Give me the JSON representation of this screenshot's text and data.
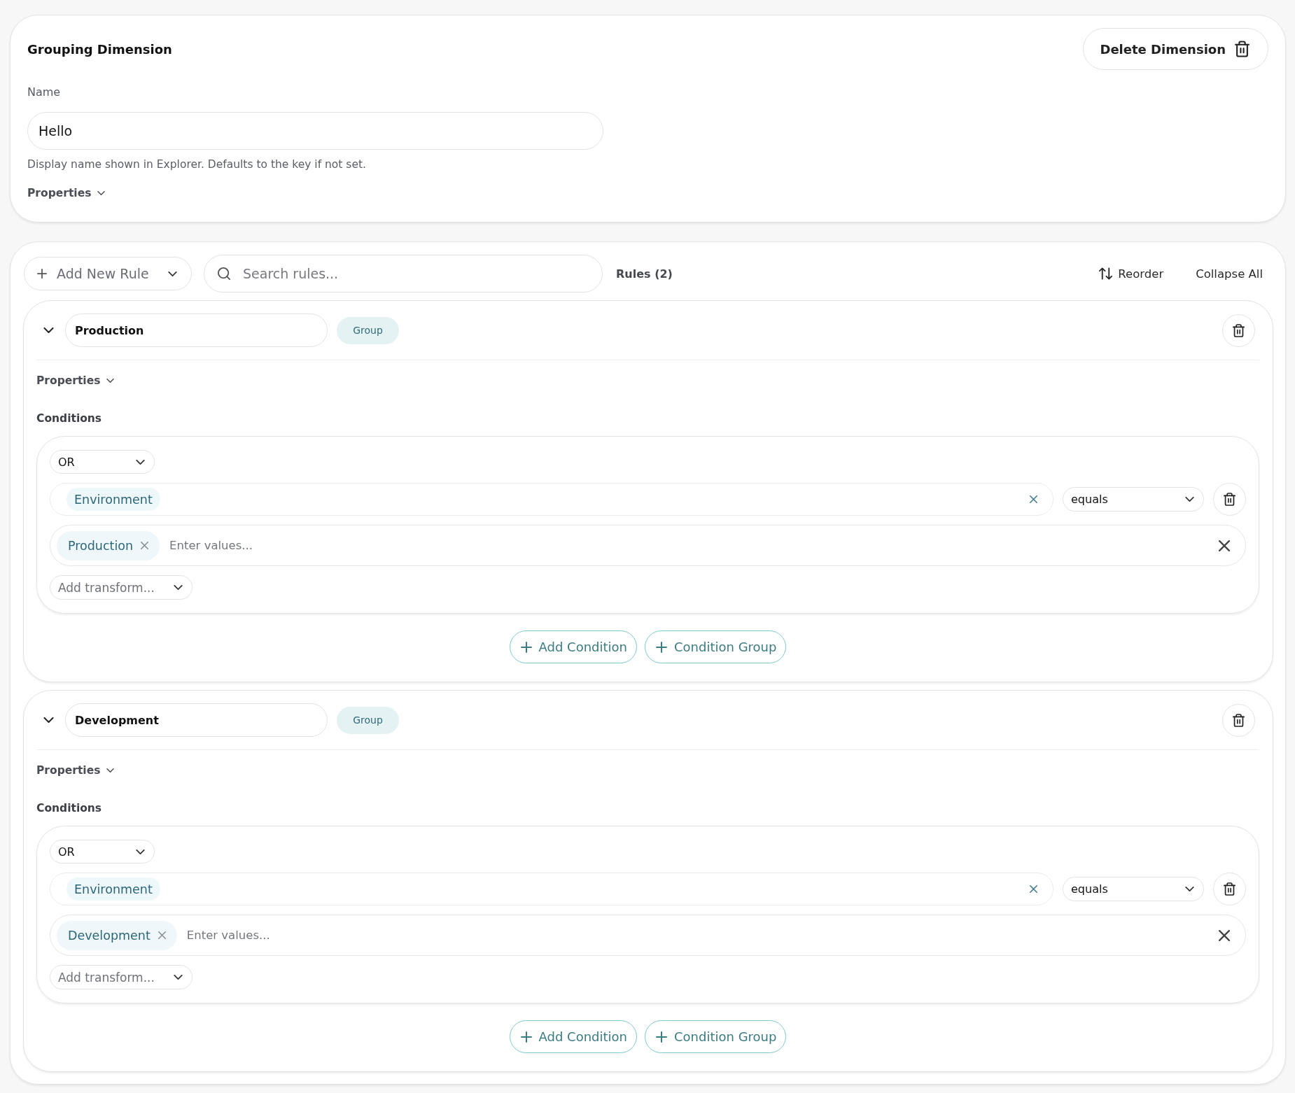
{
  "dimension": {
    "title": "Grouping Dimension",
    "delete_button": "Delete Dimension",
    "name_label": "Name",
    "name_value": "Hello",
    "name_help": "Display name shown in Explorer. Defaults to the key if not set.",
    "properties": {
      "label": "Properties",
      "expanded": false
    }
  },
  "rules_toolbar": {
    "add_button": "Add New Rule",
    "search_placeholder": "Search rules...",
    "count": "Rules (2)",
    "reorder_button": "Reorder",
    "collapse_button": "Collapse All"
  },
  "rules": [
    {
      "name": "Production",
      "badge": "Group",
      "expanded": true,
      "properties": {
        "label": "Properties",
        "expanded": false
      },
      "conditions_label": "Conditions",
      "condition_group": {
        "operator": "OR",
        "conditions": [
          {
            "field": "Environment",
            "comparator": "equals",
            "values": [
              "Production"
            ],
            "value_placeholder": "Enter values...",
            "transform_placeholder": "Add transform..."
          }
        ]
      },
      "add_condition_button": "Add Condition",
      "add_group_button": "Condition Group"
    },
    {
      "name": "Development",
      "badge": "Group",
      "expanded": true,
      "properties": {
        "label": "Properties",
        "expanded": false
      },
      "conditions_label": "Conditions",
      "condition_group": {
        "operator": "OR",
        "conditions": [
          {
            "field": "Environment",
            "comparator": "equals",
            "values": [
              "Development"
            ],
            "value_placeholder": "Enter values...",
            "transform_placeholder": "Add transform..."
          }
        ]
      },
      "add_condition_button": "Add Condition",
      "add_group_button": "Condition Group"
    }
  ]
}
